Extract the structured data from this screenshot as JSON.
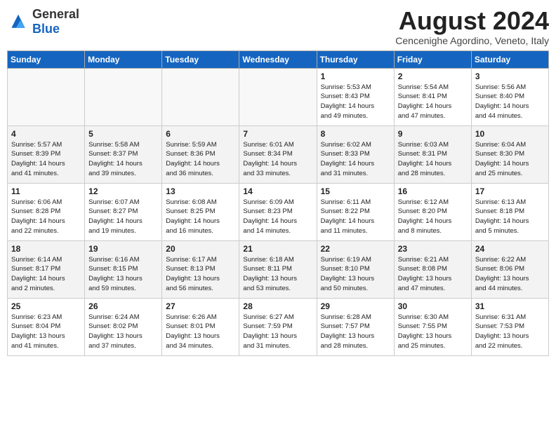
{
  "logo": {
    "text_general": "General",
    "text_blue": "Blue"
  },
  "title": "August 2024",
  "subtitle": "Cencenighe Agordino, Veneto, Italy",
  "days_of_week": [
    "Sunday",
    "Monday",
    "Tuesday",
    "Wednesday",
    "Thursday",
    "Friday",
    "Saturday"
  ],
  "weeks": [
    [
      {
        "day": "",
        "info": ""
      },
      {
        "day": "",
        "info": ""
      },
      {
        "day": "",
        "info": ""
      },
      {
        "day": "",
        "info": ""
      },
      {
        "day": "1",
        "info": "Sunrise: 5:53 AM\nSunset: 8:43 PM\nDaylight: 14 hours\nand 49 minutes."
      },
      {
        "day": "2",
        "info": "Sunrise: 5:54 AM\nSunset: 8:41 PM\nDaylight: 14 hours\nand 47 minutes."
      },
      {
        "day": "3",
        "info": "Sunrise: 5:56 AM\nSunset: 8:40 PM\nDaylight: 14 hours\nand 44 minutes."
      }
    ],
    [
      {
        "day": "4",
        "info": "Sunrise: 5:57 AM\nSunset: 8:39 PM\nDaylight: 14 hours\nand 41 minutes."
      },
      {
        "day": "5",
        "info": "Sunrise: 5:58 AM\nSunset: 8:37 PM\nDaylight: 14 hours\nand 39 minutes."
      },
      {
        "day": "6",
        "info": "Sunrise: 5:59 AM\nSunset: 8:36 PM\nDaylight: 14 hours\nand 36 minutes."
      },
      {
        "day": "7",
        "info": "Sunrise: 6:01 AM\nSunset: 8:34 PM\nDaylight: 14 hours\nand 33 minutes."
      },
      {
        "day": "8",
        "info": "Sunrise: 6:02 AM\nSunset: 8:33 PM\nDaylight: 14 hours\nand 31 minutes."
      },
      {
        "day": "9",
        "info": "Sunrise: 6:03 AM\nSunset: 8:31 PM\nDaylight: 14 hours\nand 28 minutes."
      },
      {
        "day": "10",
        "info": "Sunrise: 6:04 AM\nSunset: 8:30 PM\nDaylight: 14 hours\nand 25 minutes."
      }
    ],
    [
      {
        "day": "11",
        "info": "Sunrise: 6:06 AM\nSunset: 8:28 PM\nDaylight: 14 hours\nand 22 minutes."
      },
      {
        "day": "12",
        "info": "Sunrise: 6:07 AM\nSunset: 8:27 PM\nDaylight: 14 hours\nand 19 minutes."
      },
      {
        "day": "13",
        "info": "Sunrise: 6:08 AM\nSunset: 8:25 PM\nDaylight: 14 hours\nand 16 minutes."
      },
      {
        "day": "14",
        "info": "Sunrise: 6:09 AM\nSunset: 8:23 PM\nDaylight: 14 hours\nand 14 minutes."
      },
      {
        "day": "15",
        "info": "Sunrise: 6:11 AM\nSunset: 8:22 PM\nDaylight: 14 hours\nand 11 minutes."
      },
      {
        "day": "16",
        "info": "Sunrise: 6:12 AM\nSunset: 8:20 PM\nDaylight: 14 hours\nand 8 minutes."
      },
      {
        "day": "17",
        "info": "Sunrise: 6:13 AM\nSunset: 8:18 PM\nDaylight: 14 hours\nand 5 minutes."
      }
    ],
    [
      {
        "day": "18",
        "info": "Sunrise: 6:14 AM\nSunset: 8:17 PM\nDaylight: 14 hours\nand 2 minutes."
      },
      {
        "day": "19",
        "info": "Sunrise: 6:16 AM\nSunset: 8:15 PM\nDaylight: 13 hours\nand 59 minutes."
      },
      {
        "day": "20",
        "info": "Sunrise: 6:17 AM\nSunset: 8:13 PM\nDaylight: 13 hours\nand 56 minutes."
      },
      {
        "day": "21",
        "info": "Sunrise: 6:18 AM\nSunset: 8:11 PM\nDaylight: 13 hours\nand 53 minutes."
      },
      {
        "day": "22",
        "info": "Sunrise: 6:19 AM\nSunset: 8:10 PM\nDaylight: 13 hours\nand 50 minutes."
      },
      {
        "day": "23",
        "info": "Sunrise: 6:21 AM\nSunset: 8:08 PM\nDaylight: 13 hours\nand 47 minutes."
      },
      {
        "day": "24",
        "info": "Sunrise: 6:22 AM\nSunset: 8:06 PM\nDaylight: 13 hours\nand 44 minutes."
      }
    ],
    [
      {
        "day": "25",
        "info": "Sunrise: 6:23 AM\nSunset: 8:04 PM\nDaylight: 13 hours\nand 41 minutes."
      },
      {
        "day": "26",
        "info": "Sunrise: 6:24 AM\nSunset: 8:02 PM\nDaylight: 13 hours\nand 37 minutes."
      },
      {
        "day": "27",
        "info": "Sunrise: 6:26 AM\nSunset: 8:01 PM\nDaylight: 13 hours\nand 34 minutes."
      },
      {
        "day": "28",
        "info": "Sunrise: 6:27 AM\nSunset: 7:59 PM\nDaylight: 13 hours\nand 31 minutes."
      },
      {
        "day": "29",
        "info": "Sunrise: 6:28 AM\nSunset: 7:57 PM\nDaylight: 13 hours\nand 28 minutes."
      },
      {
        "day": "30",
        "info": "Sunrise: 6:30 AM\nSunset: 7:55 PM\nDaylight: 13 hours\nand 25 minutes."
      },
      {
        "day": "31",
        "info": "Sunrise: 6:31 AM\nSunset: 7:53 PM\nDaylight: 13 hours\nand 22 minutes."
      }
    ]
  ]
}
